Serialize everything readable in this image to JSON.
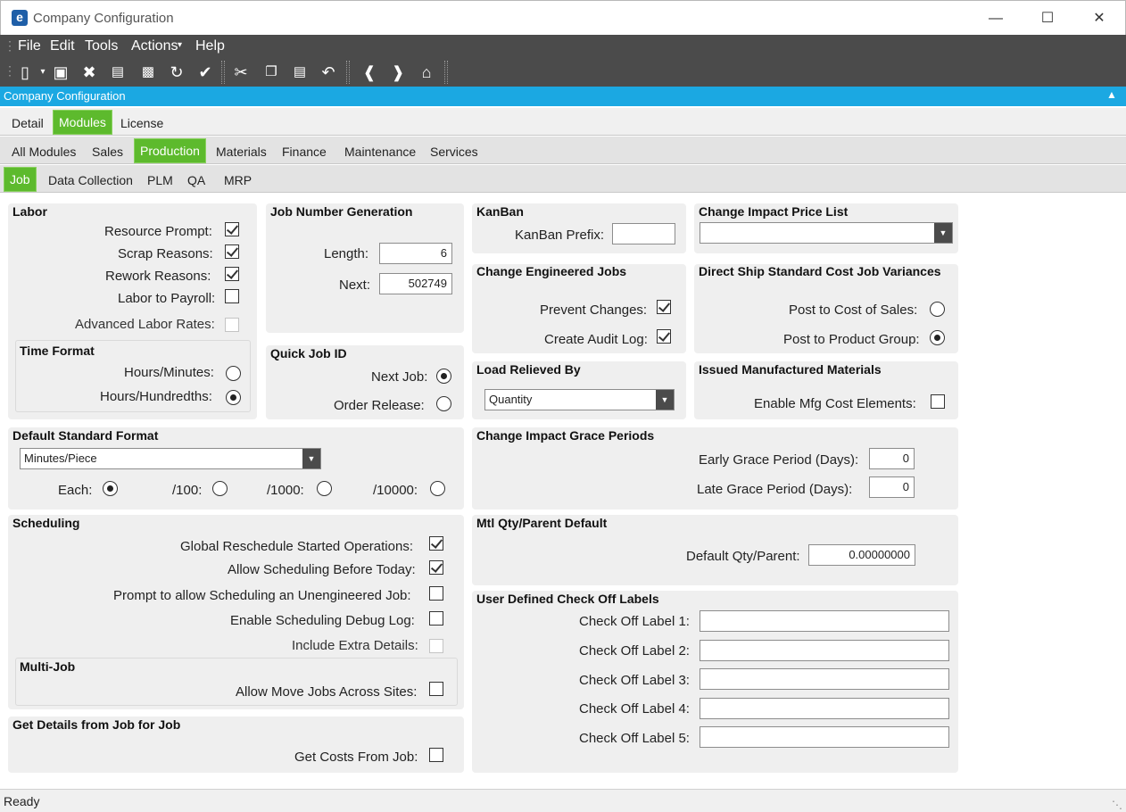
{
  "window": {
    "title": "Company Configuration",
    "icon": "e-app-icon",
    "controls": [
      "minimize-icon",
      "maximize-icon",
      "close-icon"
    ]
  },
  "menu": [
    "File",
    "Edit",
    "Tools",
    "Actions",
    "Help"
  ],
  "toolbar": [
    "new-icon",
    "save-icon",
    "delete-icon",
    "book-icon",
    "print-icon",
    "refresh-icon",
    "clear-icon",
    "cut-icon",
    "copy-icon",
    "paste-icon",
    "undo-icon",
    "back-icon",
    "forward-icon",
    "home-icon"
  ],
  "panel": {
    "title": "Company Configuration"
  },
  "tabs1": [
    "Detail",
    "Modules",
    "License"
  ],
  "tabs2": [
    "All Modules",
    "Sales",
    "Production",
    "Materials",
    "Finance",
    "Maintenance",
    "Services"
  ],
  "tabs3": [
    "Job",
    "Data Collection",
    "PLM",
    "QA",
    "MRP"
  ],
  "labor": {
    "title": "Labor",
    "resource_prompt": "Resource Prompt:",
    "scrap_reasons": "Scrap Reasons:",
    "rework_reasons": "Rework Reasons:",
    "labor_to_payroll": "Labor to Payroll:",
    "advanced_labor_rates": "Advanced Labor Rates:"
  },
  "time_format": {
    "title": "Time Format",
    "hours_minutes": "Hours/Minutes:",
    "hours_hundredths": "Hours/Hundredths:"
  },
  "job_number": {
    "title": "Job Number Generation",
    "length_label": "Length:",
    "length": "6",
    "next_label": "Next:",
    "next": "502749"
  },
  "quick_job": {
    "title": "Quick Job ID",
    "next_job": "Next Job:",
    "order_release": "Order Release:"
  },
  "kanban": {
    "title": "KanBan",
    "prefix_label": "KanBan Prefix:",
    "prefix": ""
  },
  "change_engineered": {
    "title": "Change Engineered Jobs",
    "prevent": "Prevent Changes:",
    "audit": "Create Audit Log:"
  },
  "load_relieved": {
    "title": "Load Relieved By",
    "value": "Quantity"
  },
  "price_list": {
    "title": "Change Impact Price List",
    "value": ""
  },
  "direct_ship": {
    "title": "Direct Ship Standard Cost Job Variances",
    "cost_of_sales": "Post to Cost of Sales:",
    "product_group": "Post to Product Group:"
  },
  "issued_mfg": {
    "title": "Issued Manufactured Materials",
    "enable": "Enable Mfg Cost Elements:"
  },
  "default_std": {
    "title": "Default Standard Format",
    "value": "Minutes/Piece",
    "each": "Each:",
    "p100": "/100:",
    "p1000": "/1000:",
    "p10000": "/10000:"
  },
  "grace": {
    "title": "Change Impact Grace Periods",
    "early_label": "Early Grace Period (Days):",
    "early": "0",
    "late_label": "Late Grace Period (Days):",
    "late": "0"
  },
  "scheduling": {
    "title": "Scheduling",
    "global": "Global Reschedule Started Operations:",
    "before_today": "Allow Scheduling Before Today:",
    "unengineered": "Prompt to allow Scheduling an Unengineered Job:",
    "debug": "Enable Scheduling Debug Log:",
    "extra": "Include Extra Details:"
  },
  "multi_job": {
    "title": "Multi-Job",
    "move": "Allow Move Jobs Across Sites:"
  },
  "mtl_qty": {
    "title": "Mtl Qty/Parent Default",
    "label": "Default Qty/Parent:",
    "value": "0.00000000"
  },
  "checkoff": {
    "title": "User Defined Check Off Labels",
    "l1": "Check Off Label 1:",
    "l2": "Check Off Label 2:",
    "l3": "Check Off Label 3:",
    "l4": "Check Off Label 4:",
    "l5": "Check Off Label 5:"
  },
  "get_details": {
    "title": "Get Details from Job for Job",
    "costs": "Get Costs From Job:"
  },
  "status": "Ready"
}
